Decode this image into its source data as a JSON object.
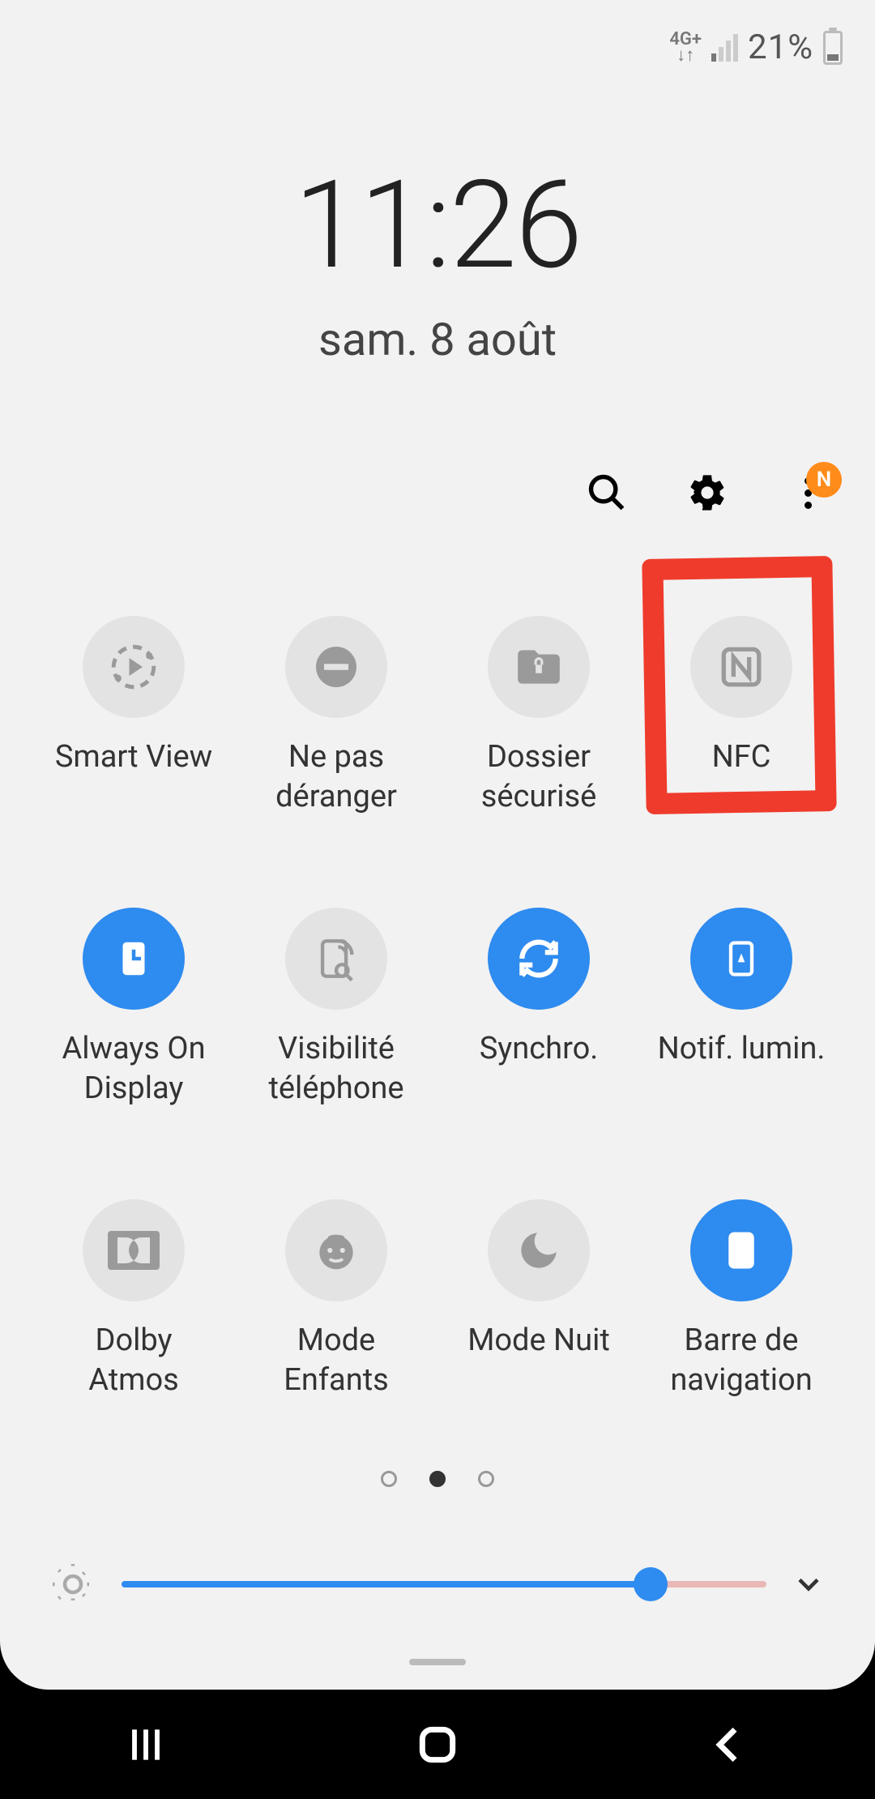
{
  "status_bar": {
    "network": "4G+",
    "battery_percent": "21%"
  },
  "clock": {
    "time": "11:26",
    "date": "sam. 8 août"
  },
  "actions": {
    "more_badge": "N"
  },
  "tiles": [
    {
      "label": "Smart View",
      "active": false,
      "icon": "smart-view"
    },
    {
      "label": "Ne pas\ndéranger",
      "active": false,
      "icon": "dnd"
    },
    {
      "label": "Dossier\nsécurisé",
      "active": false,
      "icon": "secure-folder"
    },
    {
      "label": "NFC",
      "active": false,
      "icon": "nfc",
      "highlighted": true
    },
    {
      "label": "Always On\nDisplay",
      "active": true,
      "icon": "aod"
    },
    {
      "label": "Visibilité\ntéléphone",
      "active": false,
      "icon": "visibility"
    },
    {
      "label": "Synchro.",
      "active": true,
      "icon": "sync"
    },
    {
      "label": "Notif. lumin.",
      "active": true,
      "icon": "edge-light"
    },
    {
      "label": "Dolby\nAtmos",
      "active": false,
      "icon": "dolby"
    },
    {
      "label": "Mode\nEnfants",
      "active": false,
      "icon": "kids"
    },
    {
      "label": "Mode Nuit",
      "active": false,
      "icon": "night"
    },
    {
      "label": "Barre de\nnavigation",
      "active": true,
      "icon": "navbar"
    }
  ],
  "pagination": {
    "total": 3,
    "current": 1
  },
  "brightness": {
    "value": 82
  },
  "annotation": {
    "highlight_color": "#ef3b2c"
  }
}
